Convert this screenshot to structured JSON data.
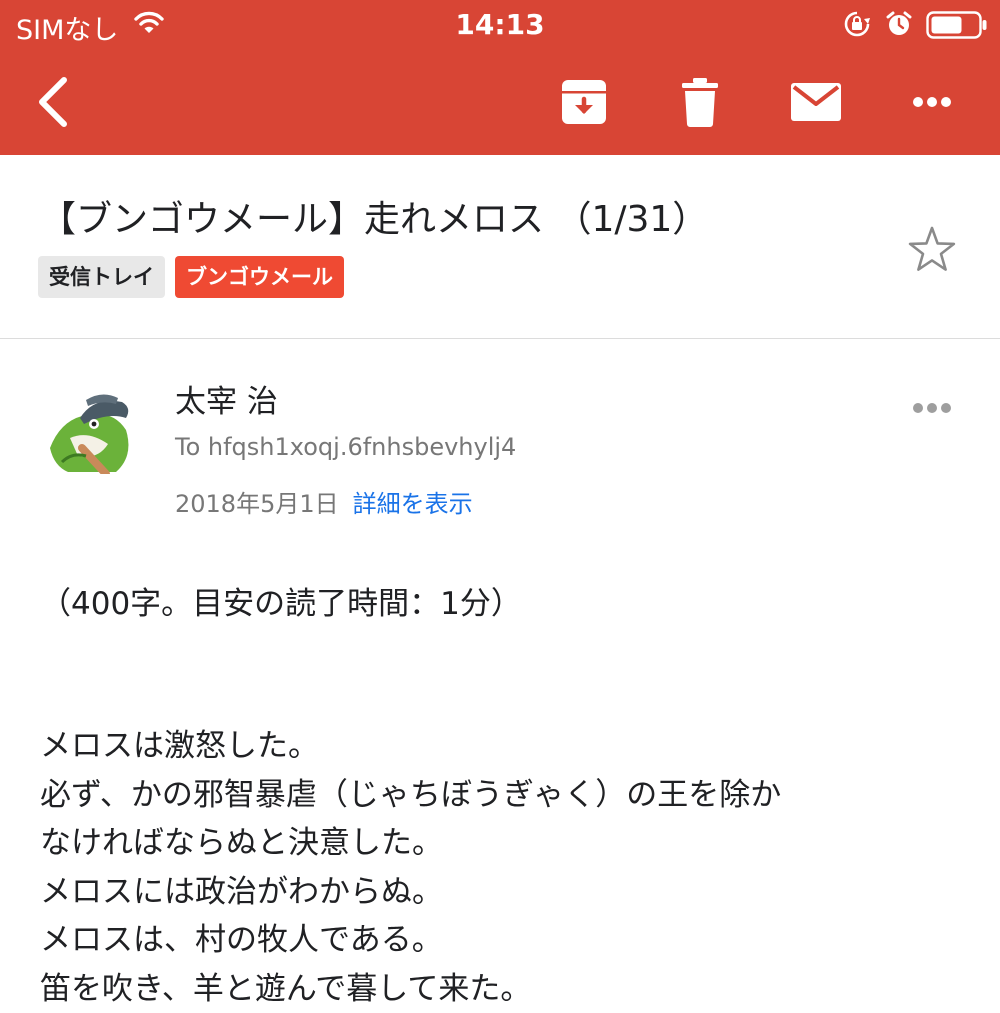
{
  "status_bar": {
    "carrier": "SIMなし",
    "time": "14:13",
    "icons": [
      "wifi-icon",
      "rotation-lock-icon",
      "alarm-icon",
      "battery-icon"
    ]
  },
  "toolbar": {
    "icons": [
      "back-icon",
      "archive-icon",
      "trash-icon",
      "mail-icon",
      "more-icon"
    ]
  },
  "email": {
    "subject": "【ブンゴウメール】走れメロス （1/31）",
    "labels": [
      "受信トレイ",
      "ブンゴウメール"
    ],
    "sender_name": "太宰 治",
    "recipient": "To hfqsh1xoqj.6fnhsbevhylj4",
    "date": "2018年5月1日",
    "details_link": "詳細を表示",
    "intro": "（400字。目安の読了時間：1分）",
    "body_lines": [
      "メロスは激怒した。",
      "必ず、かの邪智暴虐（じゃちぼうぎゃく）の王を除か",
      "なければならぬと決意した。",
      "メロスには政治がわからぬ。",
      "メロスは、村の牧人である。",
      "笛を吹き、羊と遊んで暮して来た。"
    ]
  },
  "colors": {
    "header_bg": "#d84535",
    "label_bungo": "#ef4a33",
    "label_inbox": "#e8e8e8",
    "link": "#1a73e8"
  }
}
